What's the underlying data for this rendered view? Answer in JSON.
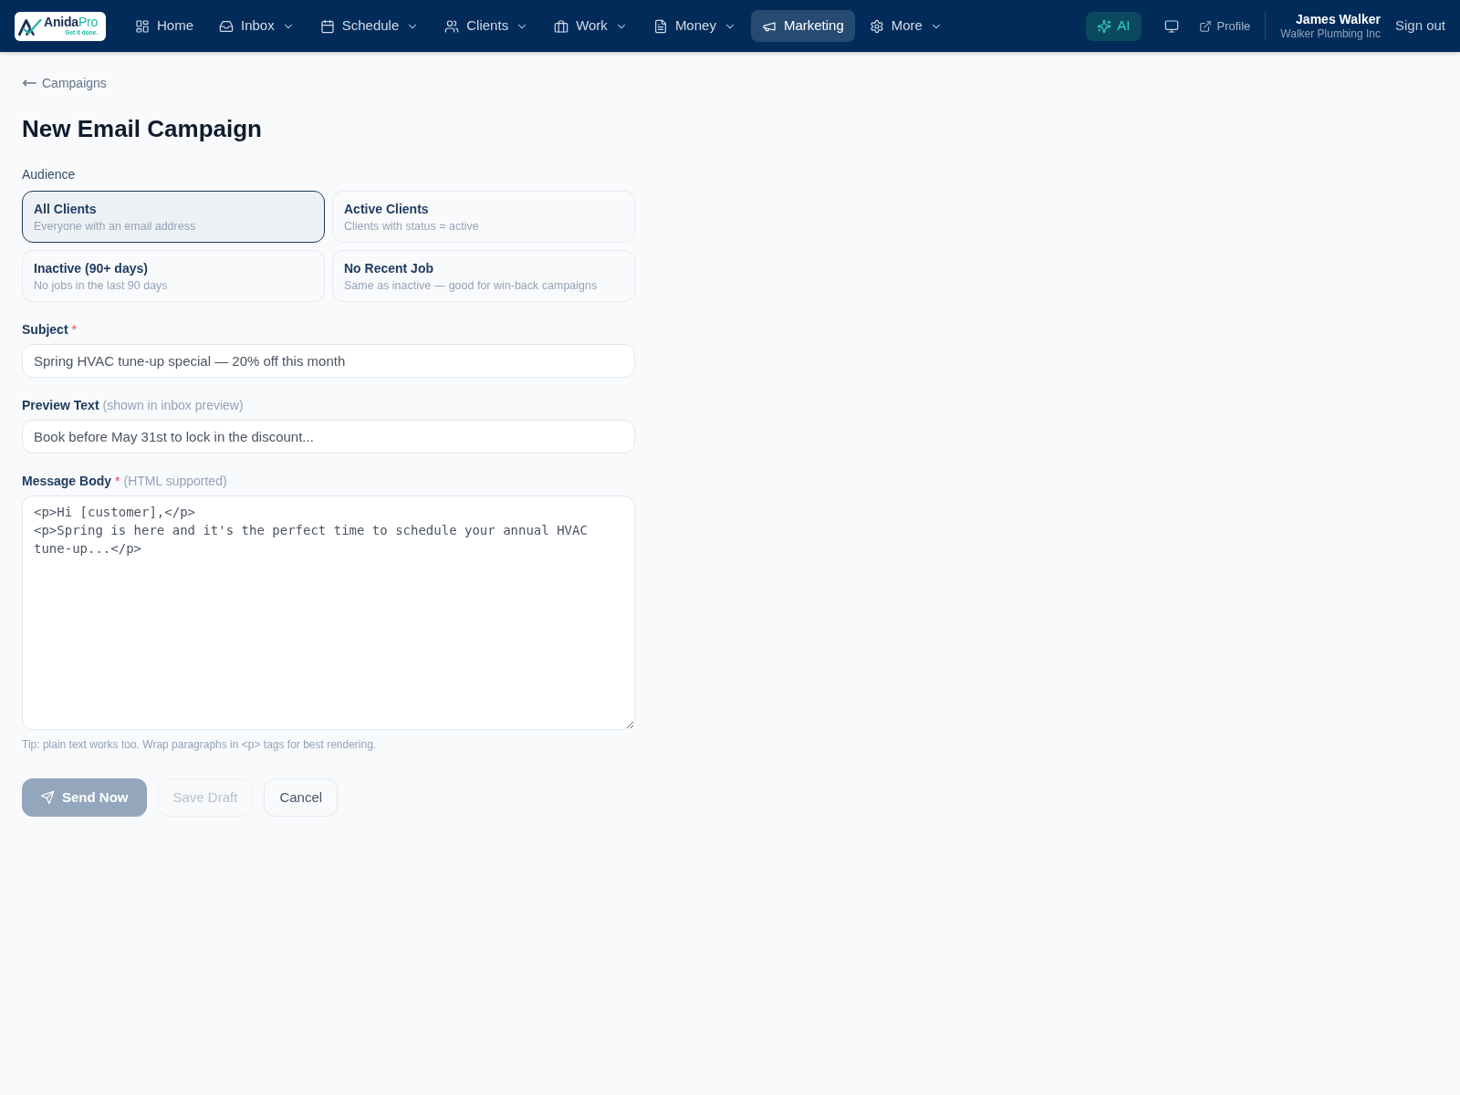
{
  "nav": {
    "logo": {
      "name": "Anida",
      "name_accent": "Pro",
      "tagline": "Get it done."
    },
    "items": [
      {
        "label": "Home",
        "has_menu": false,
        "selected": false
      },
      {
        "label": "Inbox",
        "has_menu": true,
        "selected": false
      },
      {
        "label": "Schedule",
        "has_menu": true,
        "selected": false
      },
      {
        "label": "Clients",
        "has_menu": true,
        "selected": false
      },
      {
        "label": "Work",
        "has_menu": true,
        "selected": false
      },
      {
        "label": "Money",
        "has_menu": true,
        "selected": false
      },
      {
        "label": "Marketing",
        "has_menu": false,
        "selected": true
      },
      {
        "label": "More",
        "has_menu": true,
        "selected": false
      }
    ],
    "ai_button": {
      "label": "AI"
    },
    "profile_link": {
      "label": "Profile"
    },
    "user": {
      "name": "James Walker",
      "company": "Walker Plumbing Inc"
    },
    "sign_out": {
      "label": "Sign out"
    }
  },
  "page": {
    "back_link": {
      "label": "Campaigns"
    },
    "title": "New Email Campaign",
    "audience": {
      "label": "Audience",
      "options": [
        {
          "title": "All Clients",
          "description": "Everyone with an email address",
          "selected": true
        },
        {
          "title": "Active Clients",
          "description": "Clients with status = active",
          "selected": false
        },
        {
          "title": "Inactive (90+ days)",
          "description": "No jobs in the last 90 days",
          "selected": false
        },
        {
          "title": "No Recent Job",
          "description": "Same as inactive — good for win-back campaigns",
          "selected": false
        }
      ]
    },
    "fields": [
      {
        "kind": "input",
        "label": "Subject",
        "required_mark": "*",
        "value": "Spring HVAC tune-up special — 20% off this month"
      },
      {
        "kind": "input",
        "label": "Preview Text",
        "hint": "(shown in inbox preview)",
        "value": "Book before May 31st to lock in the discount..."
      },
      {
        "kind": "textarea",
        "label": "Message Body",
        "required_mark": "*",
        "hint": "(HTML supported)",
        "value": "<p>Hi [customer],</p>\n<p>Spring is here and it's the perfect time to schedule your annual HVAC tune-up...</p>",
        "tip": "Tip: plain text works too. Wrap paragraphs in <p> tags for best rendering."
      }
    ],
    "buttons": [
      {
        "kind": "primary",
        "label": "Send Now",
        "disabled": true
      },
      {
        "kind": "secondary",
        "label": "Save Draft",
        "disabled": true
      },
      {
        "kind": "secondary",
        "label": "Cancel",
        "disabled": false
      }
    ]
  }
}
